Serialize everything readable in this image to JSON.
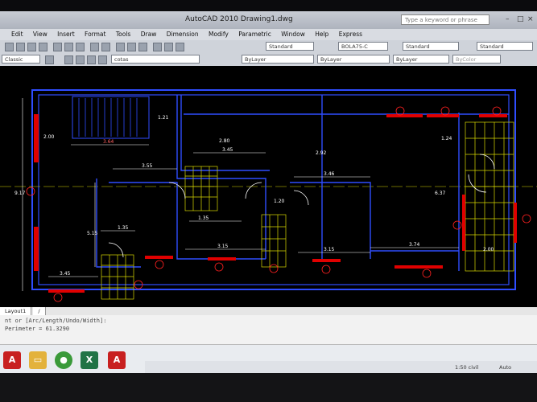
{
  "window": {
    "title": "AutoCAD 2010    Drawing1.dwg",
    "search_placeholder": "Type a keyword or phrase",
    "minimize": "–",
    "maximize": "□",
    "close": "×"
  },
  "menu": [
    "Edit",
    "View",
    "Insert",
    "Format",
    "Tools",
    "Draw",
    "Dimension",
    "Modify",
    "Parametric",
    "Window",
    "Help",
    "Express"
  ],
  "toolbar": {
    "text_style": "Standard",
    "dim_style": "BOLA75-C",
    "table_style": "Standard",
    "multileader_style": "Standard",
    "workspace": "Classic",
    "layer": "cotas",
    "color": "ByLayer",
    "linetype": "ByLayer",
    "lineweight": "ByLayer",
    "plotstyle": "ByColor"
  },
  "dimensions": {
    "d1": "3.64",
    "d2": "1.21",
    "d3": "3.55",
    "d4": "3.45",
    "d5": "2.00",
    "d6": "3.46",
    "d7": "1.20",
    "d8": "1.35",
    "d9": "3.15",
    "d10": "3.15",
    "d11": "3.74",
    "d12": "2.00",
    "d13": "3.45",
    "d14": "1.35",
    "d15": "2.80",
    "d16": "2.92",
    "d17": "6.37",
    "d18": "1.24",
    "d19": "9.17",
    "d20": "5.15"
  },
  "layout_tabs": [
    "Layout1",
    "/"
  ],
  "command_lines": [
    "nt or [Arc/Length/Undo/Width]:",
    "Perimeter = 61.3290",
    ""
  ],
  "status": {
    "scale": "1:50 civil",
    "mode": "Auto"
  }
}
